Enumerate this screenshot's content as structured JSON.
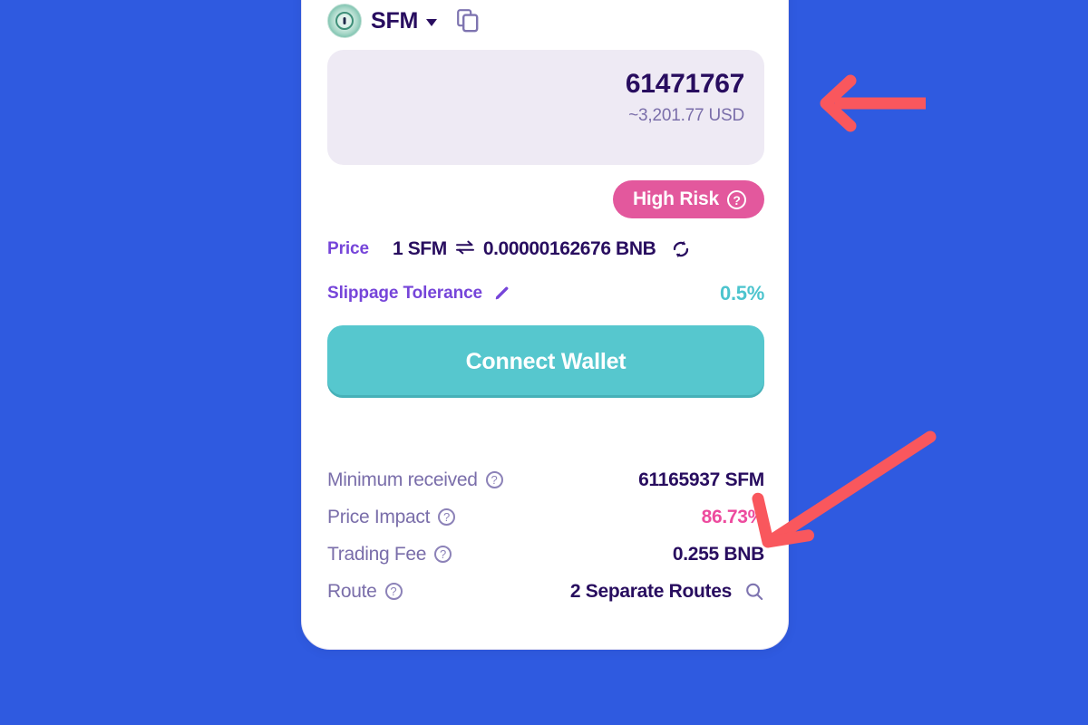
{
  "page": {
    "background_color": "#2F5AE0",
    "card_background": "#FFFFFF"
  },
  "card": {
    "token": {
      "logo_icon": "sfm-token-logo-icon",
      "symbol": "SFM",
      "dropdown_icon": "chevron-down-icon",
      "copy_icon": "copy-icon"
    },
    "amount": {
      "value": "61471767",
      "usd_estimate": "~3,201.77 USD"
    },
    "risk_badge": {
      "label": "High Risk",
      "help_icon": "question-mark-circle-icon",
      "color": "#E3589D"
    },
    "price": {
      "label": "Price",
      "base": "1 SFM",
      "swap_icon": "swap-arrows-icon",
      "quote": "0.00000162676 BNB",
      "refresh_icon": "refresh-icon"
    },
    "slippage": {
      "label": "Slippage Tolerance",
      "edit_icon": "pencil-edit-icon",
      "value": "0.5%",
      "value_color": "#4CC4CE"
    },
    "primary_action": {
      "label": "Connect Wallet",
      "color": "#56C7CE"
    },
    "details": [
      {
        "label": "Minimum received",
        "help_icon": "question-mark-circle-icon",
        "value": "61165937 SFM",
        "value_color": "#280D5F",
        "trailing_icon": ""
      },
      {
        "label": "Price Impact",
        "help_icon": "question-mark-circle-icon",
        "value": "86.73%",
        "value_color": "#ED4B9E",
        "trailing_icon": ""
      },
      {
        "label": "Trading Fee",
        "help_icon": "question-mark-circle-icon",
        "value": "0.255 BNB",
        "value_color": "#280D5F",
        "trailing_icon": ""
      },
      {
        "label": "Route",
        "help_icon": "question-mark-circle-icon",
        "value": "2 Separate Routes",
        "value_color": "#280D5F",
        "trailing_icon": "search-icon"
      }
    ]
  },
  "annotations": [
    {
      "name": "arrow-pointing-to-amount",
      "direction": "left",
      "color": "#F9575D"
    },
    {
      "name": "arrow-pointing-to-price-impact",
      "direction": "down-left",
      "color": "#F9575D"
    }
  ]
}
